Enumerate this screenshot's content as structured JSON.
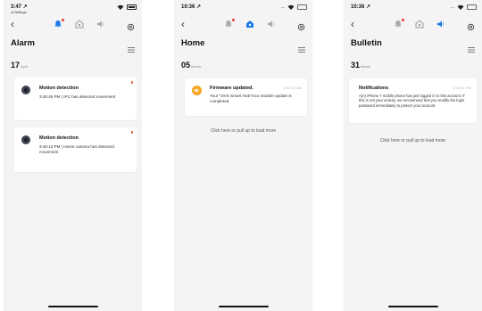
{
  "colors": {
    "accent": "#1b79e6",
    "badge_dot": "#e83a2f",
    "unread_dot": "#f0592a",
    "firmware_icon": "#f5a623",
    "screen_bg": "#f4f4f4"
  },
  "screens": [
    {
      "status": {
        "time": "3:47 ↗",
        "back_app": "◂ Settings"
      },
      "title": "Alarm",
      "active_tab": "bell",
      "date_day": "17",
      "date_month": "April",
      "cards": [
        {
          "icon": "camera-thumbnail",
          "title": "Motion detection",
          "body": "3:46:45 PM | IPC has detected movement"
        },
        {
          "icon": "camera-thumbnail",
          "title": "Motion detection",
          "body": "3:46:13 PM | Home camera has detected movement"
        }
      ]
    },
    {
      "status": {
        "time": "10:36 ↗"
      },
      "title": "Home",
      "active_tab": "home",
      "date_day": "05",
      "date_month": "March",
      "cards": [
        {
          "icon": "speaker-icon",
          "title": "Firmware updated.",
          "time": "8:59:12 AM",
          "body": "Your \"OVS Smart Hub\"mcu module update is completed."
        }
      ],
      "load_more": "Click here or pull up to load more"
    },
    {
      "status": {
        "time": "10:36 ↗"
      },
      "title": "Bulletin",
      "active_tab": "speaker",
      "date_day": "31",
      "date_month": "March",
      "cards": [
        {
          "title": "Notifications",
          "time": "3:42:51 PM",
          "body": "A(n) iPhone 7 mobile phone has just logged in to this account. If this is not your activity, we recommend that you modify the login password immediately to protect your account."
        }
      ],
      "load_more": "Click here or pull up to load more"
    }
  ]
}
